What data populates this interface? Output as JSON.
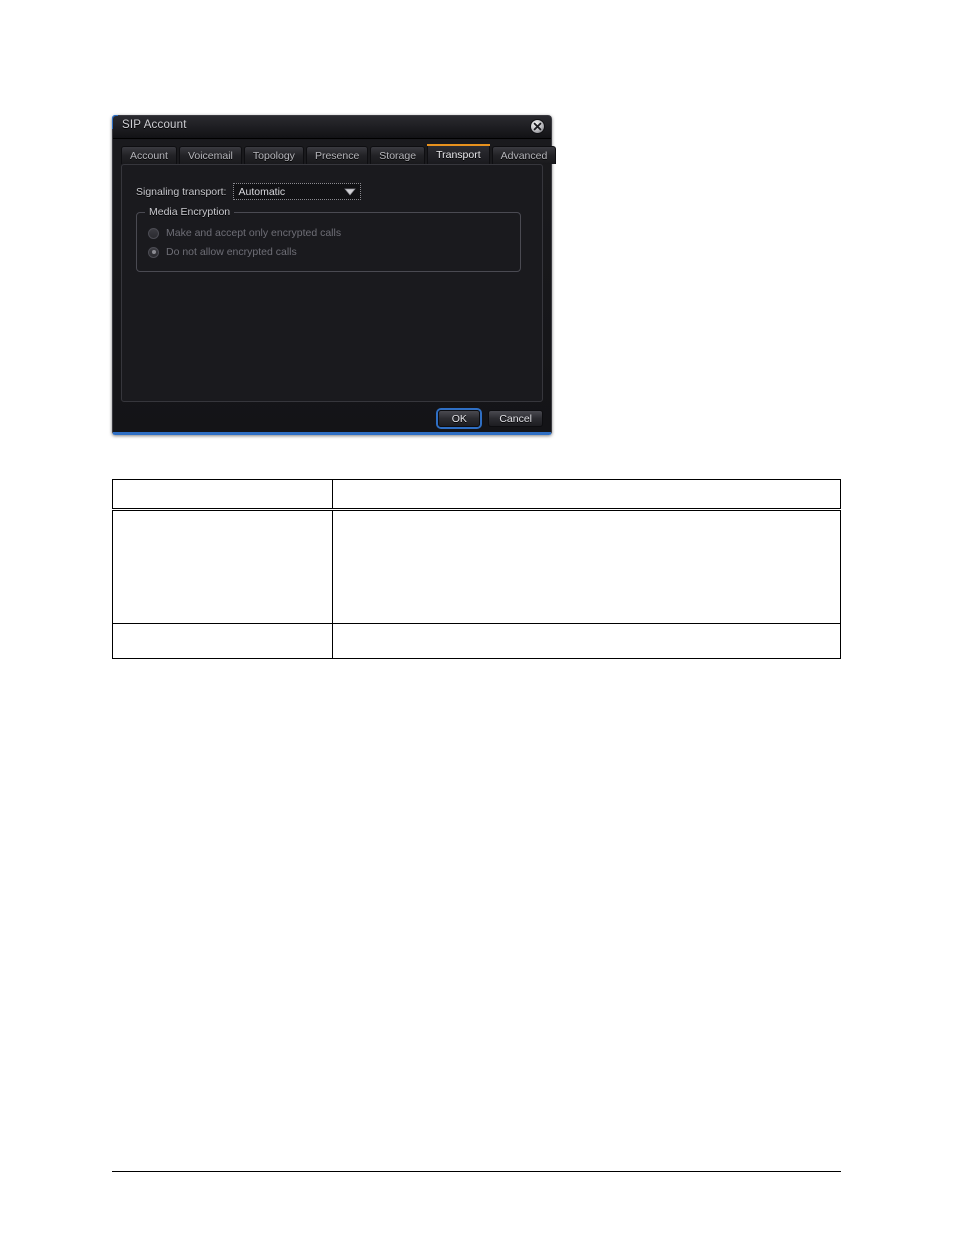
{
  "dialog": {
    "title": "SIP Account",
    "close_icon": "close-circle-icon",
    "tabs": [
      {
        "label": "Account",
        "active": false
      },
      {
        "label": "Voicemail",
        "active": false
      },
      {
        "label": "Topology",
        "active": false
      },
      {
        "label": "Presence",
        "active": false
      },
      {
        "label": "Storage",
        "active": false
      },
      {
        "label": "Transport",
        "active": true
      },
      {
        "label": "Advanced",
        "active": false
      }
    ],
    "signaling_transport": {
      "label": "Signaling transport:",
      "value": "Automatic",
      "arrow_icon": "chevron-down-icon"
    },
    "media_encryption": {
      "legend": "Media Encryption",
      "options": [
        {
          "label": "Make and accept only encrypted calls",
          "selected": false
        },
        {
          "label": "Do not allow encrypted calls",
          "selected": true
        }
      ]
    },
    "buttons": {
      "ok": "OK",
      "cancel": "Cancel"
    },
    "accent_color": "#e8921e",
    "focus_color": "#2f6fc4"
  },
  "table": {
    "rows": [
      {
        "kind": "head",
        "cells": [
          "",
          ""
        ]
      },
      {
        "kind": "row1",
        "cells": [
          "",
          ""
        ]
      },
      {
        "kind": "row2",
        "cells": [
          "",
          ""
        ]
      }
    ]
  }
}
